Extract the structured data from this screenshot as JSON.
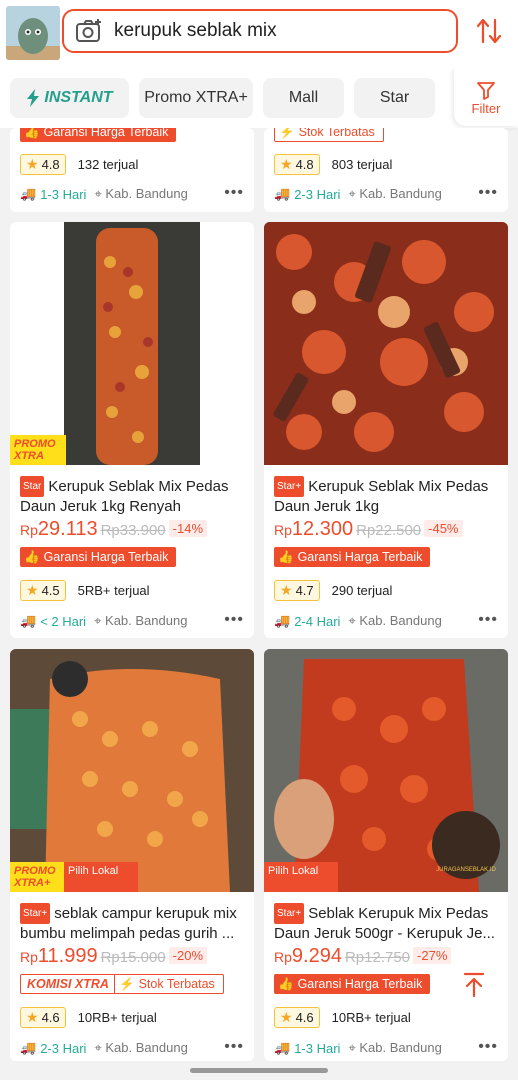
{
  "search": {
    "query": "kerupuk seblak mix"
  },
  "filters": {
    "instant": "INSTANT",
    "promo": "Promo XTRA+",
    "mall": "Mall",
    "star": "Star",
    "filter": "Filter"
  },
  "colors": {
    "accent": "#ee4d2d",
    "teal": "#26aa99",
    "star": "#f5a623"
  },
  "top_partial": [
    {
      "badge": "Garansi Harga Terbaik",
      "rating": "4.8",
      "sold": "132 terjual",
      "ship": "1-3 Hari",
      "loc": "Kab. Bandung"
    },
    {
      "badge": "Stok Terbatas",
      "rating": "4.8",
      "sold": "803 terjual",
      "ship": "2-3 Hari",
      "loc": "Kab. Bandung"
    }
  ],
  "products": [
    {
      "tag": "Star",
      "title": "Kerupuk Seblak Mix Pedas Daun Jeruk 1kg Renyah",
      "rp": "Rp",
      "price": "29.113",
      "old": "Rp33.900",
      "disc": "-14%",
      "badge": "Garansi Harga Terbaik",
      "rating": "4.5",
      "sold": "5RB+ terjual",
      "ship": "< 2 Hari",
      "loc": "Kab. Bandung",
      "overlay": "PROMO XTRA"
    },
    {
      "tag": "Star+",
      "title": "Kerupuk Seblak Mix Pedas Daun Jeruk 1kg",
      "rp": "Rp",
      "price": "12.300",
      "old": "Rp22.500",
      "disc": "-45%",
      "badge": "Garansi Harga Terbaik",
      "rating": "4.7",
      "sold": "290 terjual",
      "ship": "2-4 Hari",
      "loc": "Kab. Bandung"
    },
    {
      "tag": "Star+",
      "title": "seblak campur kerupuk mix bumbu melimpah pedas gurih ...",
      "rp": "Rp",
      "price": "11.999",
      "old": "Rp15.000",
      "disc": "-20%",
      "badge1": "KOMISI XTRA",
      "badge2": "Stok Terbatas",
      "rating": "4.6",
      "sold": "10RB+ terjual",
      "ship": "2-3 Hari",
      "loc": "Kab. Bandung",
      "overlay": "PROMO XTRA+",
      "lokal": "Pilih Lokal"
    },
    {
      "tag": "Star+",
      "title": "Seblak Kerupuk Mix Pedas Daun Jeruk 500gr - Kerupuk Je...",
      "rp": "Rp",
      "price": "9.294",
      "old": "Rp12.750",
      "disc": "-27%",
      "badge": "Garansi Harga Terbaik",
      "rating": "4.6",
      "sold": "10RB+ terjual",
      "ship": "1-3 Hari",
      "loc": "Kab. Bandung",
      "lokal": "Pilih Lokal",
      "watermark": "JURAGANSEBLAK.ID"
    }
  ]
}
